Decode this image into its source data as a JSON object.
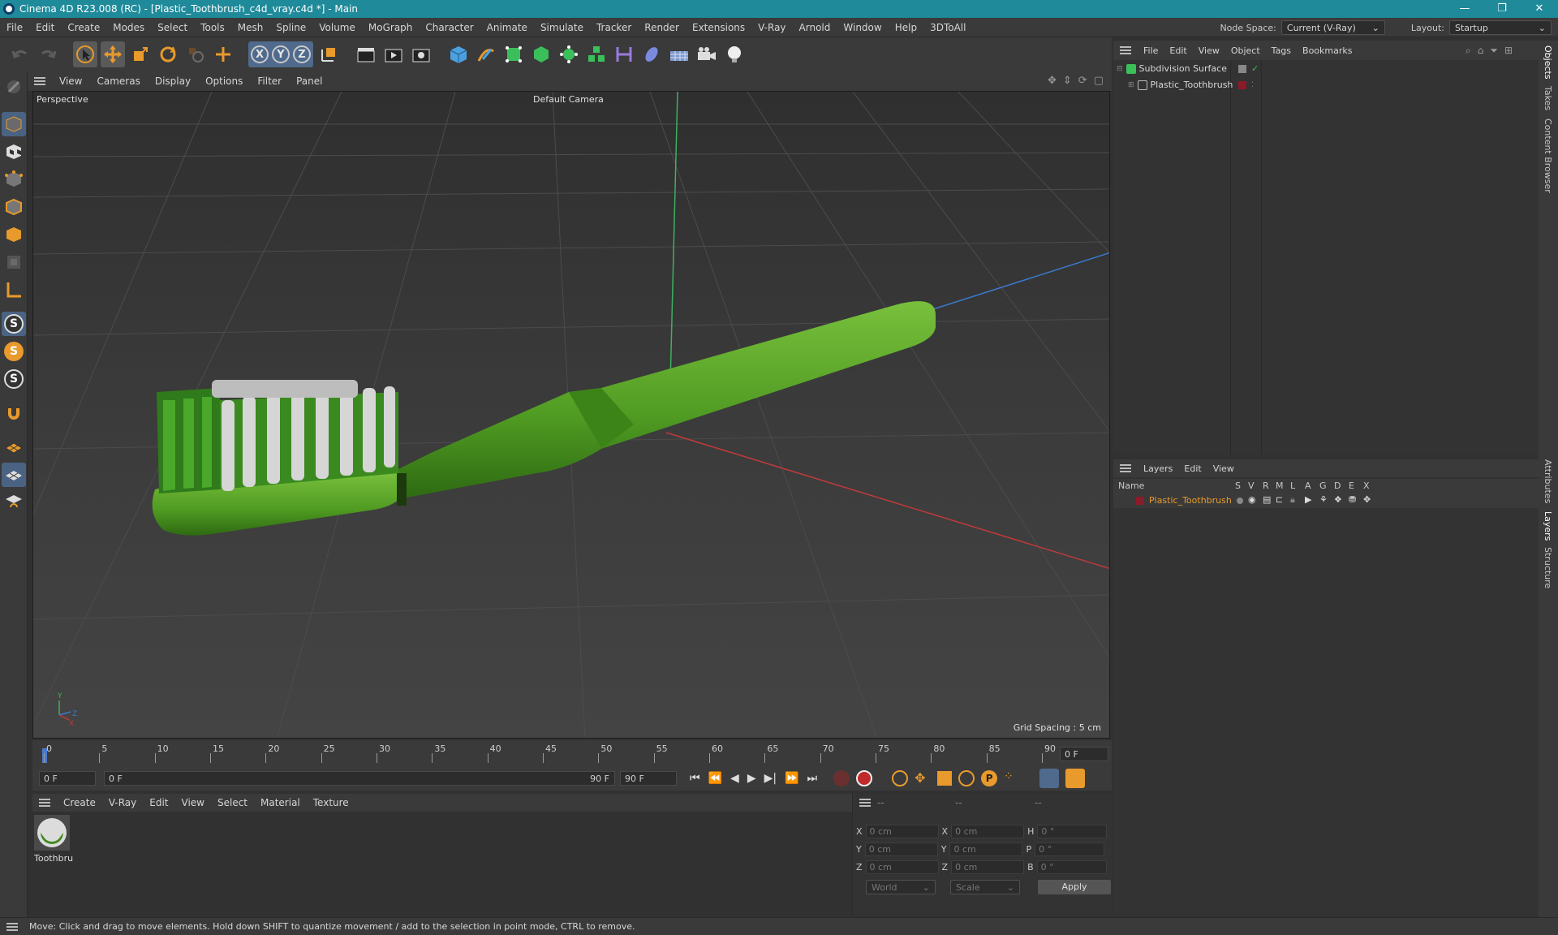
{
  "window": {
    "title": "Cinema 4D R23.008 (RC) - [Plastic_Toothbrush_c4d_vray.c4d *] - Main",
    "controls": [
      "—",
      "❐",
      "✕"
    ]
  },
  "menubar": {
    "items": [
      "File",
      "Edit",
      "Create",
      "Modes",
      "Select",
      "Tools",
      "Mesh",
      "Spline",
      "Volume",
      "MoGraph",
      "Character",
      "Animate",
      "Simulate",
      "Tracker",
      "Render",
      "Extensions",
      "V-Ray",
      "Arnold",
      "Window",
      "Help",
      "3DToAll"
    ],
    "node_space_label": "Node Space:",
    "node_space_value": "Current (V-Ray)",
    "layout_label": "Layout:",
    "layout_value": "Startup"
  },
  "toolbar": {
    "axis": [
      "X",
      "Y",
      "Z"
    ]
  },
  "viewport": {
    "menu": [
      "View",
      "Cameras",
      "Display",
      "Options",
      "Filter",
      "Panel"
    ],
    "view_name": "Perspective",
    "camera": "Default Camera",
    "grid_spacing": "Grid Spacing : 5 cm",
    "axis_y": "Y",
    "axis_z": "Z",
    "axis_x": "X"
  },
  "timeline": {
    "ticks": [
      "0",
      "5",
      "10",
      "15",
      "20",
      "25",
      "30",
      "35",
      "40",
      "45",
      "50",
      "55",
      "60",
      "65",
      "70",
      "75",
      "80",
      "85",
      "90"
    ],
    "current_frame": "0 F",
    "start_field": "0 F",
    "range_start": "0 F",
    "range_end": "90 F",
    "end_field": "90 F"
  },
  "material_manager": {
    "menu": [
      "Create",
      "V-Ray",
      "Edit",
      "View",
      "Select",
      "Material",
      "Texture"
    ],
    "materials": [
      {
        "name": "Toothbru"
      }
    ]
  },
  "coordinates": {
    "headers": [
      "--",
      "--",
      "--"
    ],
    "rows": [
      {
        "a": "X",
        "v1": "0 cm",
        "b": "X",
        "v2": "0 cm",
        "c": "H",
        "v3": "0 °"
      },
      {
        "a": "Y",
        "v1": "0 cm",
        "b": "Y",
        "v2": "0 cm",
        "c": "P",
        "v3": "0 °"
      },
      {
        "a": "Z",
        "v1": "0 cm",
        "b": "Z",
        "v2": "0 cm",
        "c": "B",
        "v3": "0 °"
      }
    ],
    "mode": "World",
    "type": "Scale",
    "apply": "Apply"
  },
  "object_manager": {
    "menu": [
      "File",
      "Edit",
      "View",
      "Object",
      "Tags",
      "Bookmarks"
    ],
    "objects": [
      {
        "name": "Subdivision Surface"
      },
      {
        "name": "Plastic_Toothbrush"
      }
    ]
  },
  "layer_manager": {
    "menu": [
      "Layers",
      "Edit",
      "View"
    ],
    "columns": [
      "Name",
      "S",
      "V",
      "R",
      "M",
      "L",
      "A",
      "G",
      "D",
      "E",
      "X"
    ],
    "layers": [
      {
        "name": "Plastic_Toothbrush",
        "color": "#8b1a2a"
      }
    ]
  },
  "side_tabs": [
    "Objects",
    "Takes",
    "Content Browser",
    "Attributes",
    "Layers",
    "Structure"
  ],
  "status": "Move: Click and drag to move elements. Hold down SHIFT to quantize movement / add to the selection in point mode, CTRL to remove.",
  "colors": {
    "titlebar": "#1f8a9a",
    "accent_orange": "#e89a2c",
    "toothbrush_green": "#5a9a2a",
    "layer_color": "#8b1a2a"
  }
}
